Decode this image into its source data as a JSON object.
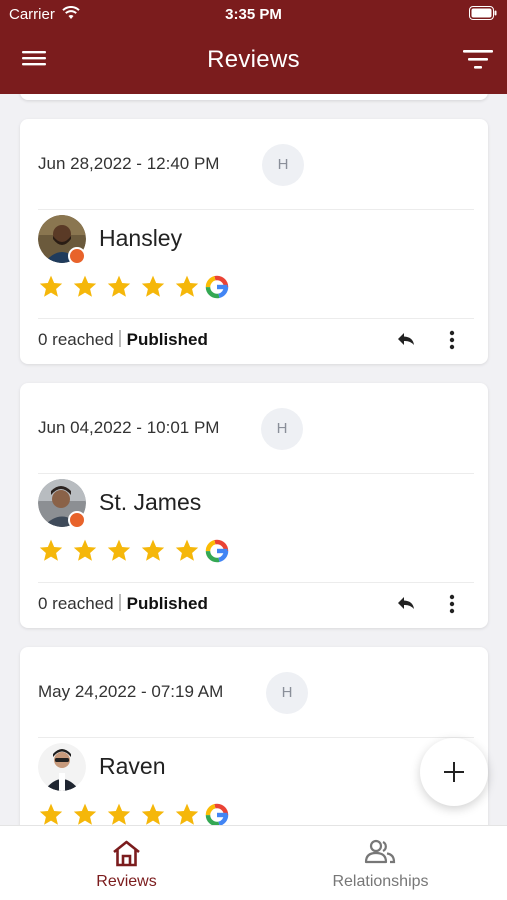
{
  "status_bar": {
    "carrier": "Carrier",
    "time": "3:35 PM"
  },
  "header": {
    "title": "Reviews",
    "menu_icon": "hamburger-menu-icon",
    "filter_icon": "filter-icon"
  },
  "reviews": [
    {
      "date": "Jun 28,2022 - 12:40 PM",
      "initial": "H",
      "name": "Hansley",
      "rating": 5,
      "source": "google-icon",
      "reached": "0 reached",
      "status": "Published"
    },
    {
      "date": "Jun 04,2022 - 10:01 PM",
      "initial": "H",
      "name": "St. James",
      "rating": 5,
      "source": "google-icon",
      "reached": "0 reached",
      "status": "Published"
    },
    {
      "date": "May 24,2022 - 07:19 AM",
      "initial": "H",
      "name": "Raven",
      "rating": 5,
      "source": "google-icon"
    }
  ],
  "fab": {
    "icon": "plus-icon"
  },
  "tabbar": {
    "tabs": [
      {
        "label": "Reviews",
        "icon": "home-icon",
        "active": true
      },
      {
        "label": "Relationships",
        "icon": "people-icon",
        "active": false
      }
    ]
  },
  "colors": {
    "brand": "#7b1c1d",
    "star": "#f5b70a",
    "inactive_tab": "#777777"
  }
}
